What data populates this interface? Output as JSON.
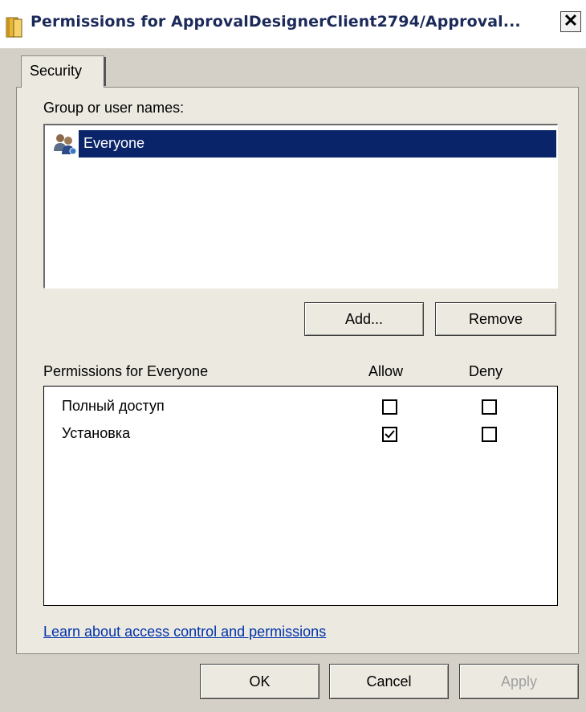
{
  "window": {
    "title": "Permissions for ApprovalDesignerClient2794/Approval...",
    "close_glyph": "✕"
  },
  "tabs": [
    {
      "label": "Security",
      "selected": true
    }
  ],
  "group_section": {
    "label": "Group or user names:",
    "items": [
      {
        "label": "Everyone",
        "icon": "users-icon",
        "selected": true
      }
    ]
  },
  "buttons": {
    "add": "Add...",
    "remove": "Remove",
    "ok": "OK",
    "cancel": "Cancel",
    "apply": "Apply"
  },
  "permissions": {
    "header": "Permissions for Everyone",
    "allow_header": "Allow",
    "deny_header": "Deny",
    "rows": [
      {
        "name": "Полный доступ",
        "allow": false,
        "deny": false
      },
      {
        "name": "Установка",
        "allow": true,
        "deny": false
      }
    ]
  },
  "link": "Learn about access control and permissions",
  "colors": {
    "selection": "#0a246a",
    "link": "#0033aa",
    "title_text": "#1c2a5a",
    "dialog_bg": "#ece9e1"
  }
}
